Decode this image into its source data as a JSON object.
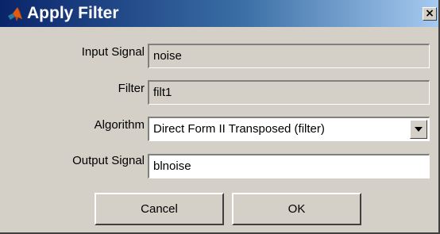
{
  "window": {
    "title": "Apply Filter",
    "close_glyph": "×"
  },
  "form": {
    "input_signal": {
      "label": "Input Signal",
      "value": "noise"
    },
    "filter": {
      "label": "Filter",
      "value": "filt1"
    },
    "algorithm": {
      "label": "Algorithm",
      "selected": "Direct Form II Transposed (filter)"
    },
    "output_signal": {
      "label": "Output Signal",
      "value": "blnoise"
    }
  },
  "buttons": {
    "cancel": "Cancel",
    "ok": "OK"
  },
  "colors": {
    "titlebar_start": "#0a246a",
    "titlebar_end": "#a6caf0",
    "dialog_face": "#d4d0c8"
  }
}
